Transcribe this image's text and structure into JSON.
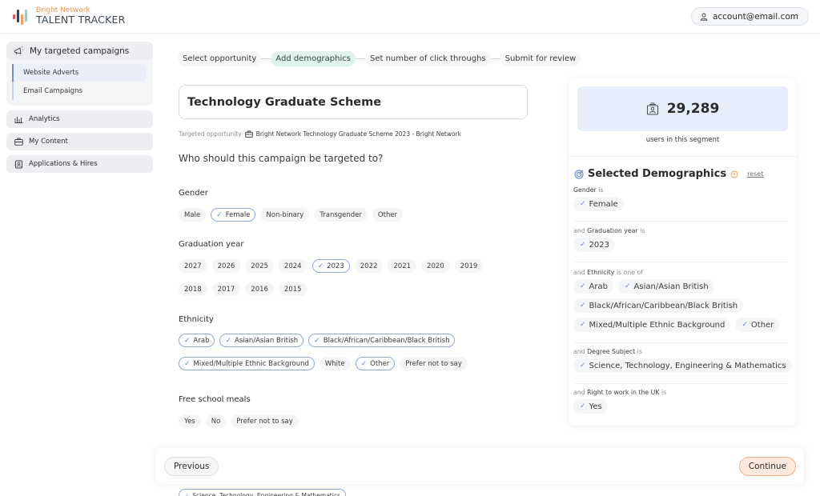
{
  "header": {
    "brand": "Bright Network",
    "product": "TALENT TRACKER",
    "account": "account@email.com",
    "logo_colors": [
      "#e05a6a",
      "#3b4656",
      "#f0a060",
      "#8fd3c3"
    ]
  },
  "sidebar": {
    "campaigns_label": "My targeted campaigns",
    "sub_items": [
      {
        "label": "Website Adverts",
        "active": true
      },
      {
        "label": "Email Campaigns",
        "active": false
      }
    ],
    "items": [
      {
        "label": "Analytics",
        "icon": "analytics-icon"
      },
      {
        "label": "My Content",
        "icon": "briefcase-icon"
      },
      {
        "label": "Applications & Hires",
        "icon": "applications-icon"
      }
    ]
  },
  "stepper": {
    "steps": [
      "Select opportunity",
      "Add demographics",
      "Set number of click throughs",
      "Submit for review"
    ],
    "active_index": 1
  },
  "form": {
    "campaign_title": "Technology Graduate Scheme",
    "targeted_label": "Targeted opportunity",
    "targeted_value": "Bright Network Technology Graduate Scheme 2023 - Bright Network",
    "question": "Who should this campaign be targeted to?",
    "sections": {
      "gender": {
        "label": "Gender",
        "options": [
          {
            "label": "Male",
            "selected": false
          },
          {
            "label": "Female",
            "selected": true
          },
          {
            "label": "Non-binary",
            "selected": false
          },
          {
            "label": "Transgender",
            "selected": false
          },
          {
            "label": "Other",
            "selected": false
          }
        ]
      },
      "graduation_year": {
        "label": "Graduation year",
        "options": [
          {
            "label": "2027",
            "selected": false
          },
          {
            "label": "2026",
            "selected": false
          },
          {
            "label": "2025",
            "selected": false
          },
          {
            "label": "2024",
            "selected": false
          },
          {
            "label": "2023",
            "selected": true
          },
          {
            "label": "2022",
            "selected": false
          },
          {
            "label": "2021",
            "selected": false
          },
          {
            "label": "2020",
            "selected": false
          },
          {
            "label": "2019",
            "selected": false
          },
          {
            "label": "2018",
            "selected": false
          },
          {
            "label": "2017",
            "selected": false
          },
          {
            "label": "2016",
            "selected": false
          },
          {
            "label": "2015",
            "selected": false
          }
        ]
      },
      "ethnicity": {
        "label": "Ethnicity",
        "options": [
          {
            "label": "Arab",
            "selected": true
          },
          {
            "label": "Asian/Asian British",
            "selected": true
          },
          {
            "label": "Black/African/Caribbean/Black British",
            "selected": true
          },
          {
            "label": "Mixed/Multiple Ethnic Background",
            "selected": true
          },
          {
            "label": "White",
            "selected": false
          },
          {
            "label": "Other",
            "selected": true
          },
          {
            "label": "Prefer not to say",
            "selected": false
          }
        ]
      },
      "free_school_meals": {
        "label": "Free school meals",
        "options": [
          {
            "label": "Yes",
            "selected": false
          },
          {
            "label": "No",
            "selected": false
          },
          {
            "label": "Prefer not to say",
            "selected": false
          }
        ]
      }
    },
    "peek_chip": "Science, Technology, Engineering & Mathematics"
  },
  "summary": {
    "count": "29,289",
    "count_label": "users in this segment",
    "title": "Selected Demographics",
    "reset": "reset",
    "blocks": [
      {
        "prefix": "",
        "field": "Gender",
        "suffix": "is",
        "values": [
          "Female"
        ]
      },
      {
        "prefix": "and",
        "field": "Graduation year",
        "suffix": "is",
        "values": [
          "2023"
        ]
      },
      {
        "prefix": "and",
        "field": "Ethnicity",
        "suffix": "is one of",
        "values": [
          "Arab",
          "Asian/Asian British",
          "Black/African/Caribbean/Black British",
          "Mixed/Multiple Ethnic Background",
          "Other"
        ]
      },
      {
        "prefix": "and",
        "field": "Degree Subject",
        "suffix": "is",
        "values": [
          "Science, Technology, Engineering & Mathematics"
        ]
      },
      {
        "prefix": "and",
        "field": "Right to work in the UK",
        "suffix": "is",
        "values": [
          "Yes"
        ]
      }
    ]
  },
  "footer": {
    "previous": "Previous",
    "continue": "Continue"
  },
  "colors": {
    "accent_blue": "#8fa8e0",
    "active_step": "#dff2ec",
    "count_bg": "#e7eefb",
    "continue_bg": "#fde9dc",
    "continue_border": "#f1b185",
    "warning": "#f0a040"
  }
}
